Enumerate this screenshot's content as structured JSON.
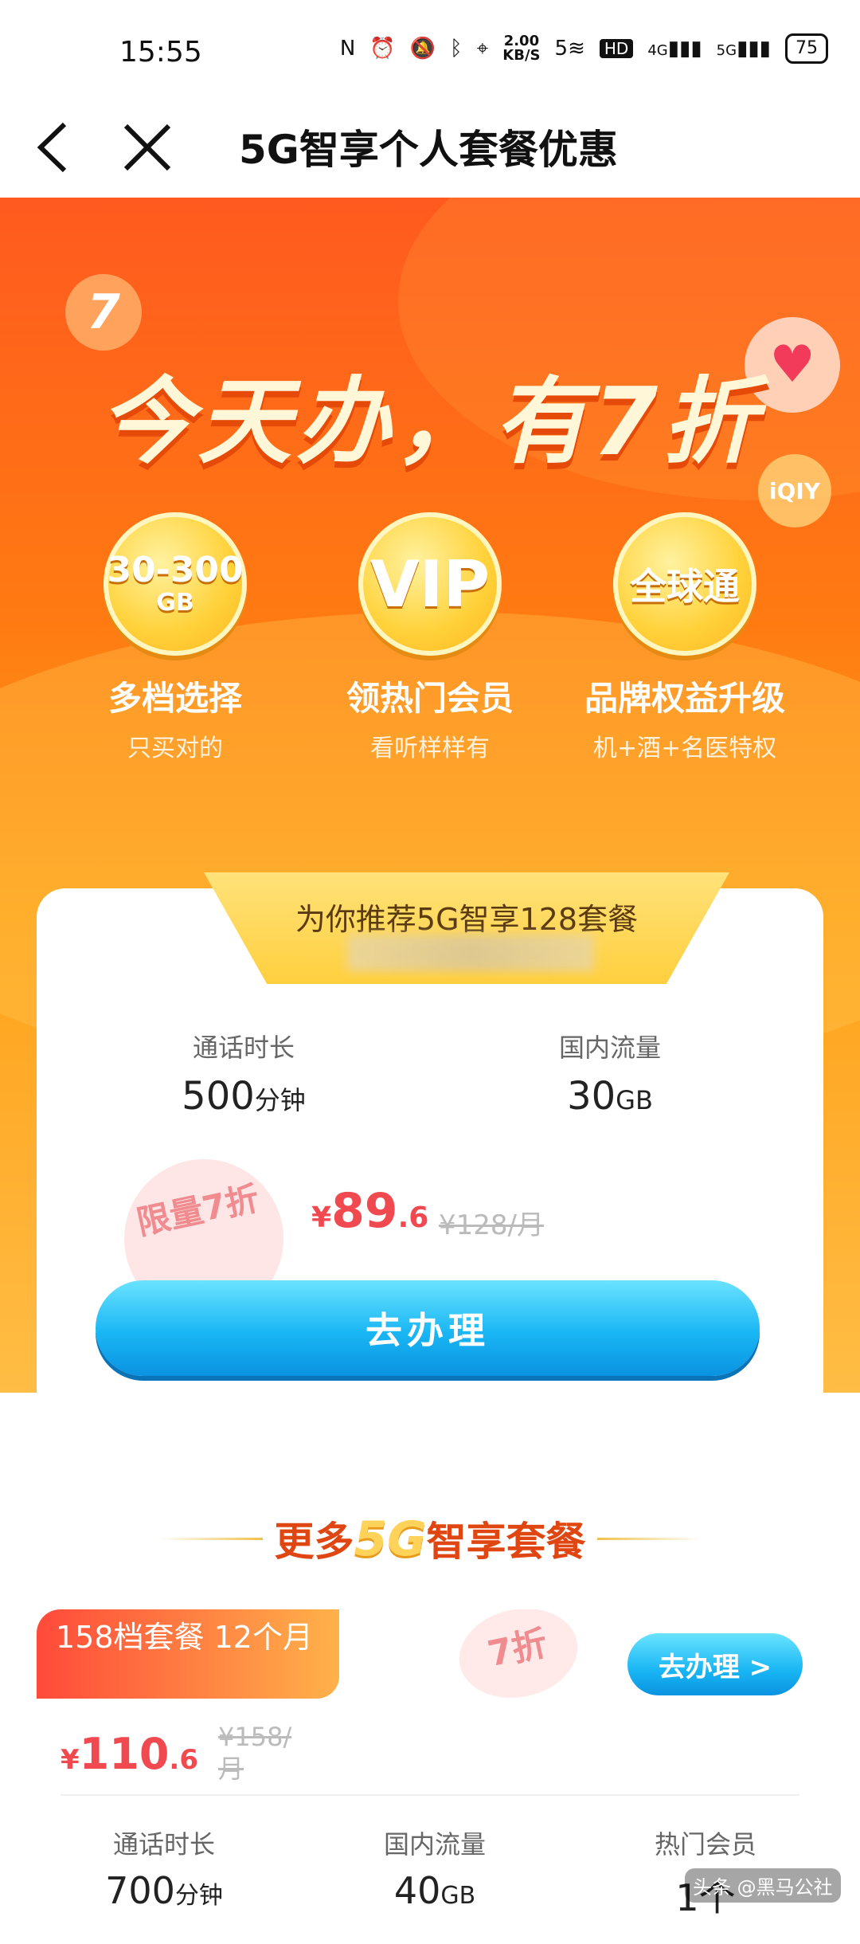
{
  "status_bar": {
    "time": "15:55",
    "net_speed_value": "2.00",
    "net_speed_unit": "KB/S",
    "wifi_label": "5",
    "hd_label": "HD",
    "sim1_label": "4G",
    "sim2_label": "5G",
    "battery": "75"
  },
  "nav": {
    "title": "5G智享个人套餐优惠"
  },
  "hero": {
    "headline": "今天办，有7折",
    "badge_text": "7",
    "iqiyi_text": "iQIY",
    "features": [
      {
        "coin_big": "30-300",
        "coin_small": "GB",
        "title": "多档选择",
        "subtitle": "只买对的"
      },
      {
        "coin_big": "VIP",
        "coin_small": "",
        "title": "领热门会员",
        "subtitle": "看听样样有"
      },
      {
        "coin_big": "全球通",
        "coin_small": "",
        "title": "品牌权益升级",
        "subtitle": "机+酒+名医特权"
      }
    ]
  },
  "recommend": {
    "ribbon_text": "为你推荐5G智享128套餐",
    "call_label": "通话时长",
    "call_value": "500",
    "call_unit": "分钟",
    "data_label": "国内流量",
    "data_value": "30",
    "data_unit": "GB",
    "limit_text": "限量7折",
    "price_symbol": "¥",
    "price_int": "89",
    "price_dec": ".6",
    "old_price": "¥128/月",
    "button_label": "去办理"
  },
  "more": {
    "title_prefix": "更多",
    "title_5g": "5G",
    "title_suffix": "智享套餐"
  },
  "package_158": {
    "tag": "158档套餐 12个月",
    "seal": "7折",
    "button_label": "去办理 >",
    "price_symbol": "¥",
    "price_int": "110",
    "price_dec": ".6",
    "old_price": "¥158/月",
    "call_label": "通话时长",
    "call_value": "700",
    "call_unit": "分钟",
    "data_label": "国内流量",
    "data_value": "40",
    "data_unit": "GB",
    "member_label": "热门会员",
    "member_value": "1个"
  },
  "watermark": "头条 @黑马公社"
}
